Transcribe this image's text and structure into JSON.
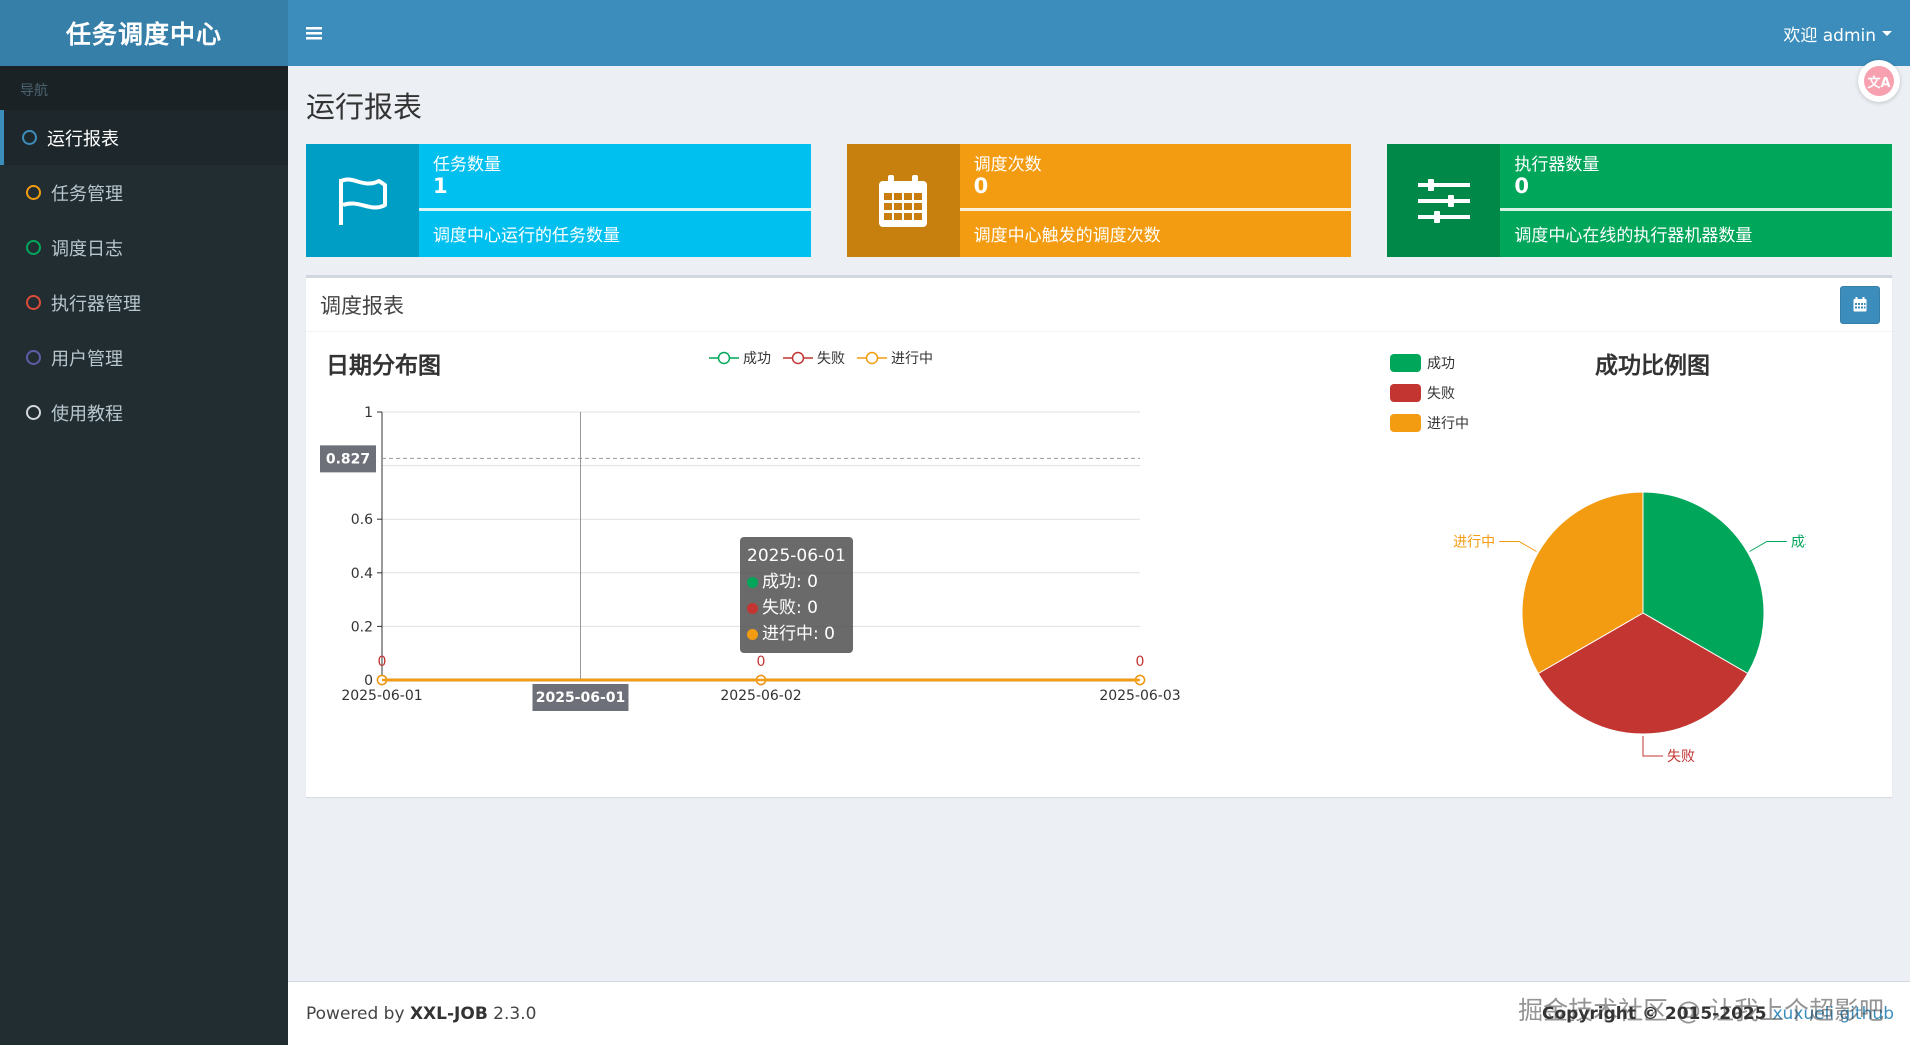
{
  "app": {
    "title": "任务调度中心"
  },
  "sidebar": {
    "header": "导航",
    "items": [
      {
        "label": "运行报表",
        "color": "#3c8dbc",
        "active": true
      },
      {
        "label": "任务管理",
        "color": "#f39c12"
      },
      {
        "label": "调度日志",
        "color": "#00a65a"
      },
      {
        "label": "执行器管理",
        "color": "#dd4b39"
      },
      {
        "label": "用户管理",
        "color": "#605ca8"
      },
      {
        "label": "使用教程",
        "color": "#d2d6de"
      }
    ]
  },
  "topbar": {
    "menu_icon": "hamburger-icon",
    "user_label": "欢迎 admin"
  },
  "page": {
    "title": "运行报表"
  },
  "info_boxes": [
    {
      "label": "任务数量",
      "number": "1",
      "desc": "调度中心运行的任务数量",
      "icon": "flag-icon",
      "color": "#00c0ef"
    },
    {
      "label": "调度次数",
      "number": "0",
      "desc": "调度中心触发的调度次数",
      "icon": "calendar-icon",
      "color": "#f39c12"
    },
    {
      "label": "执行器数量",
      "number": "0",
      "desc": "调度中心在线的执行器机器数量",
      "icon": "sliders-icon",
      "color": "#00a65a"
    }
  ],
  "report": {
    "title": "调度报表",
    "date_button_icon": "calendar-icon"
  },
  "chart_data": [
    {
      "type": "line",
      "title": "日期分布图",
      "x": [
        "2025-06-01",
        "2025-06-02",
        "2025-06-03"
      ],
      "ylim": [
        0,
        1
      ],
      "yticks": [
        "0",
        "0.2",
        "0.4",
        "0.6",
        "1"
      ],
      "series": [
        {
          "name": "成功",
          "values": [
            0,
            0,
            0
          ],
          "color": "#00a65a"
        },
        {
          "name": "失败",
          "values": [
            0,
            0,
            0
          ],
          "color": "#c23531"
        },
        {
          "name": "进行中",
          "values": [
            0,
            0,
            0
          ],
          "color": "#f39c12"
        }
      ],
      "data_labels": [
        "0",
        "0",
        "0"
      ],
      "crosshair": {
        "x_label": "2025-06-01",
        "y_label": "0.827"
      },
      "tooltip": {
        "title": "2025-06-01",
        "rows": [
          "成功: 0",
          "失败: 0",
          "进行中: 0"
        ]
      },
      "legend_position": "top-center",
      "grid": true
    },
    {
      "type": "pie",
      "title": "成功比例图",
      "slices": [
        {
          "name": "成功",
          "value": 1,
          "color": "#00a65a"
        },
        {
          "name": "失败",
          "value": 1,
          "color": "#c23531"
        },
        {
          "name": "进行中",
          "value": 1,
          "color": "#f39c12"
        }
      ],
      "legend_position": "top-left"
    }
  ],
  "footer": {
    "powered_prefix": "Powered by ",
    "product": "XXL-JOB",
    "version": " 2.3.0",
    "copyright": "Copyright © 2015-2025 ",
    "link1": "xuxueli",
    "link2": "github"
  },
  "watermark": "掘金技术社区 @ 让我上个超影吧"
}
